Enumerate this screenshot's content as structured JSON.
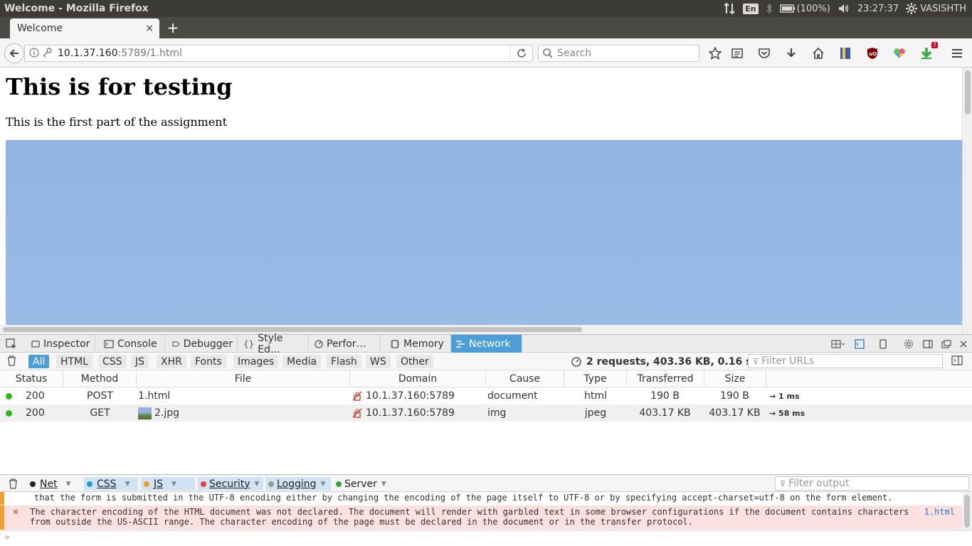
{
  "os": {
    "window_title": "Welcome - Mozilla Firefox",
    "lang": "En",
    "battery": "(100%)",
    "time": "23:27:37",
    "user": "VASISHTH"
  },
  "browser": {
    "tab_title": "Welcome",
    "tab_close": "×",
    "new_tab": "+",
    "url_host": "10.1.37.160",
    "url_path": ":5789/1.html",
    "search_placeholder": "Search",
    "notification_badge": "7"
  },
  "page": {
    "heading": "This is for testing",
    "paragraph": "This is the first part of the assignment"
  },
  "devtools": {
    "tabs": [
      {
        "label": "Inspector",
        "icon": "inspector-icon"
      },
      {
        "label": "Console",
        "icon": "console-icon"
      },
      {
        "label": "Debugger",
        "icon": "debugger-icon"
      },
      {
        "label": "Style Ed…",
        "icon": "braces-icon"
      },
      {
        "label": "Perfor…",
        "icon": "performance-icon"
      },
      {
        "label": "Memory",
        "icon": "memory-icon"
      },
      {
        "label": "Network",
        "icon": "network-icon"
      }
    ],
    "active_tab": "Network"
  },
  "network": {
    "filters": [
      "All",
      "HTML",
      "CSS",
      "JS",
      "XHR",
      "Fonts",
      "Images",
      "Media",
      "Flash",
      "WS",
      "Other"
    ],
    "active_filter": "All",
    "summary": "2 requests, 403.36 KB, 0.16 s",
    "filter_placeholder": "Filter URLs",
    "columns": [
      "Status",
      "Method",
      "File",
      "Domain",
      "Cause",
      "Type",
      "Transferred",
      "Size"
    ],
    "rows": [
      {
        "status": "200",
        "method": "POST",
        "file": "1.html",
        "domain": "10.1.37.160:5789",
        "cause": "document",
        "type": "html",
        "transferred": "190 B",
        "size": "190 B",
        "timing": "→ 1 ms"
      },
      {
        "status": "200",
        "method": "GET",
        "file": "2.jpg",
        "domain": "10.1.37.160:5789",
        "cause": "img",
        "type": "jpeg",
        "transferred": "403.17 KB",
        "size": "403.17 KB",
        "timing": "→ 58 ms"
      }
    ],
    "status_color": "#2cbb0f"
  },
  "console": {
    "filters": [
      {
        "label": "Net",
        "color": "#222222"
      },
      {
        "label": "CSS",
        "color": "#1f9ed8"
      },
      {
        "label": "JS",
        "color": "#f09c24"
      },
      {
        "label": "Security",
        "color": "#e04040"
      },
      {
        "label": "Logging",
        "color": "#999999"
      },
      {
        "label": "Server",
        "color": "#40a040"
      }
    ],
    "filter_placeholder": "Filter output",
    "messages": [
      {
        "text": "that the form is submitted in the UTF-8 encoding either by changing the encoding of the page itself to UTF-8 or by specifying accept-charset=utf-8 on the form element."
      },
      {
        "text": "The character encoding of the HTML document was not declared. The document will render with garbled text in some browser configurations if the document contains characters from outside the US-ASCII range. The character encoding of the page must be declared in the document or in the transfer protocol.",
        "location": "1.html"
      }
    ],
    "prompt": "»"
  }
}
